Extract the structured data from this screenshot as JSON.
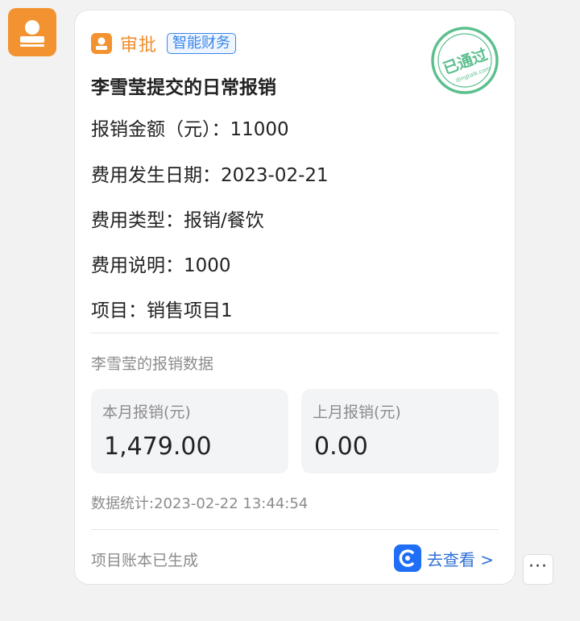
{
  "card": {
    "app_name": "审批",
    "app_tag": "智能财务",
    "title": "李雪莹提交的日常报销",
    "stamp": {
      "text": "已通过",
      "subtext": "dingtalk.com"
    },
    "fields": [
      {
        "label": "报销金额（元）：",
        "value": "11000"
      },
      {
        "label": "费用发生日期：",
        "value": "2023-02-21"
      },
      {
        "label": "费用类型：",
        "value": "报销/餐饮"
      },
      {
        "label": "费用说明：",
        "value": "1000"
      },
      {
        "label": "项目：",
        "value": "销售项目1"
      }
    ],
    "stats": {
      "section_label": "李雪莹的报销数据",
      "this_month": {
        "label": "本月报销(元)",
        "value": "1,479.00"
      },
      "last_month": {
        "label": "上月报销(元)",
        "value": "0.00"
      },
      "timestamp": "数据统计:2023-02-22 13:44:54"
    },
    "footer": {
      "note": "项目账本已生成",
      "link_label": "去查看 >"
    }
  },
  "more_button": {
    "label": "···"
  },
  "colors": {
    "accent_orange": "#f39230",
    "link_blue": "#2f6fd6",
    "stamp_green": "#5bbf8d"
  }
}
